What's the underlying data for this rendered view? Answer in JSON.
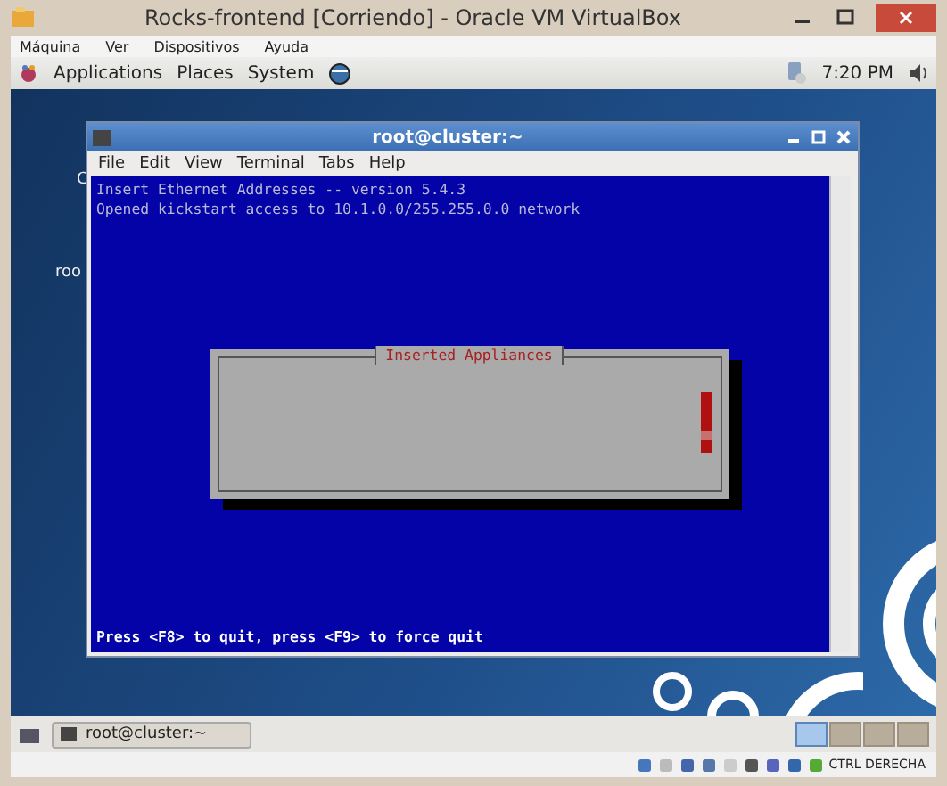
{
  "window": {
    "title": "Rocks-frontend [Corriendo] - Oracle VM VirtualBox"
  },
  "menu": [
    "Máquina",
    "Ver",
    "Dispositivos",
    "Ayuda"
  ],
  "top_panel": {
    "menus": [
      "Applications",
      "Places",
      "System"
    ],
    "clock": "7:20 PM"
  },
  "desktop_labels": [
    "C",
    "roo"
  ],
  "terminal": {
    "title": "root@cluster:~",
    "menu": [
      "File",
      "Edit",
      "View",
      "Terminal",
      "Tabs",
      "Help"
    ],
    "lines": [
      "Insert Ethernet Addresses -- version 5.4.3",
      "Opened kickstart access to 10.1.0.0/255.255.0.0 network"
    ],
    "dialog": {
      "title": "Inserted Appliances"
    },
    "footer": "Press <F8> to quit, press <F9> to force quit"
  },
  "taskbar": {
    "tasks": [
      "root@cluster:~"
    ],
    "workspaces": [
      {
        "selected": true
      },
      {
        "selected": false
      },
      {
        "selected": false
      },
      {
        "selected": false
      }
    ]
  },
  "status_bar": {
    "host_key": "CTRL DERECHA"
  }
}
